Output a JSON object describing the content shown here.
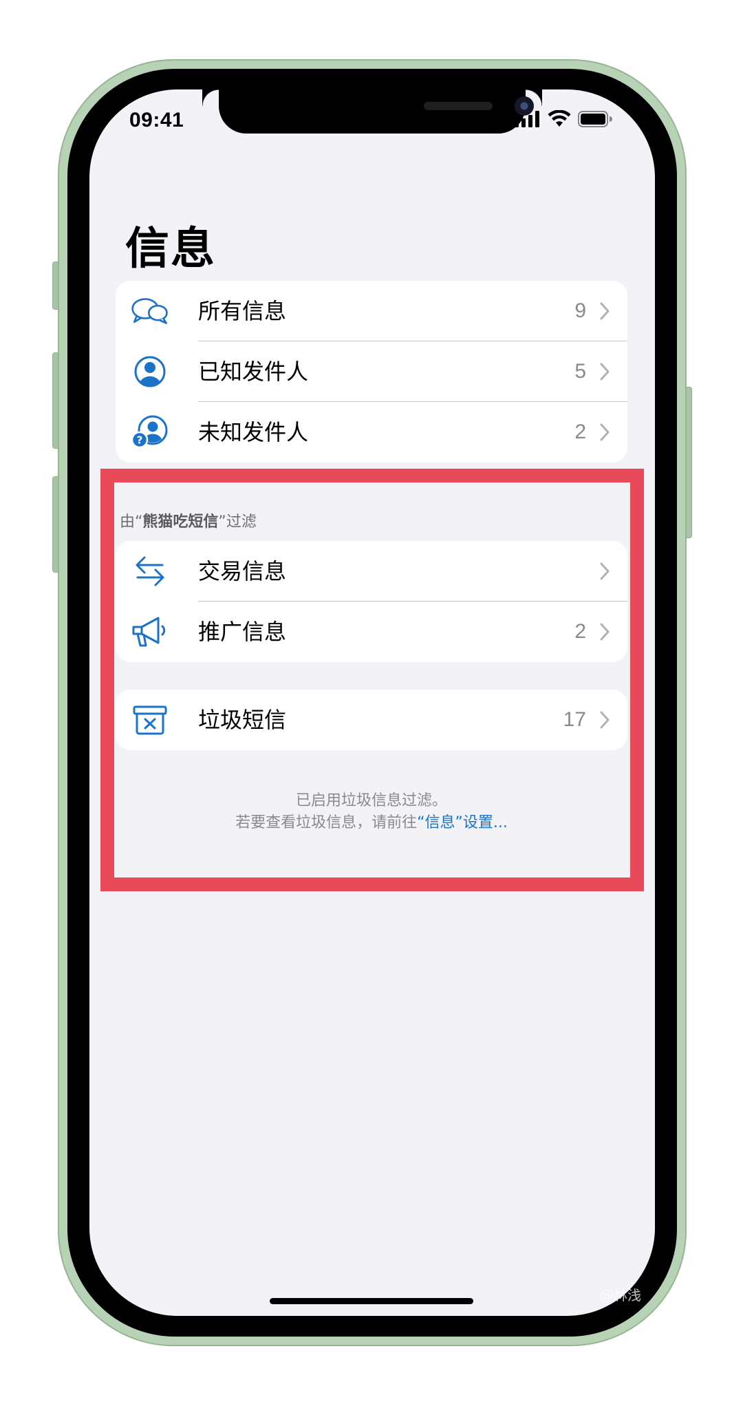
{
  "status_bar": {
    "time": "09:41",
    "icons": [
      "cellular-signal-icon",
      "wifi-icon",
      "battery-icon"
    ]
  },
  "page": {
    "title": "信息"
  },
  "groups": {
    "primary": [
      {
        "label": "所有信息",
        "count": "9",
        "icon": "chat-bubbles-icon"
      },
      {
        "label": "已知发件人",
        "count": "5",
        "icon": "person-circle-icon"
      },
      {
        "label": "未知发件人",
        "count": "2",
        "icon": "unknown-person-icon"
      }
    ],
    "filter_header": {
      "prefix": "由“",
      "app": "熊猫吃短信",
      "suffix": "”过滤"
    },
    "filtered": [
      {
        "label": "交易信息",
        "count": "",
        "icon": "arrows-swap-icon"
      },
      {
        "label": "推广信息",
        "count": "2",
        "icon": "megaphone-icon"
      }
    ],
    "junk": [
      {
        "label": "垃圾短信",
        "count": "17",
        "icon": "trash-box-icon"
      }
    ]
  },
  "footer": {
    "line1": "已启用垃圾信息过滤。",
    "line2_prefix": "若要查看垃圾信息，请前往",
    "line2_link": "“信息”设置..."
  },
  "colors": {
    "accent": "#1a73c8",
    "highlight": "#e84a5a",
    "background": "#f2f2f7",
    "phone_frame": "#b8d2b5"
  },
  "watermark": "@林浅"
}
